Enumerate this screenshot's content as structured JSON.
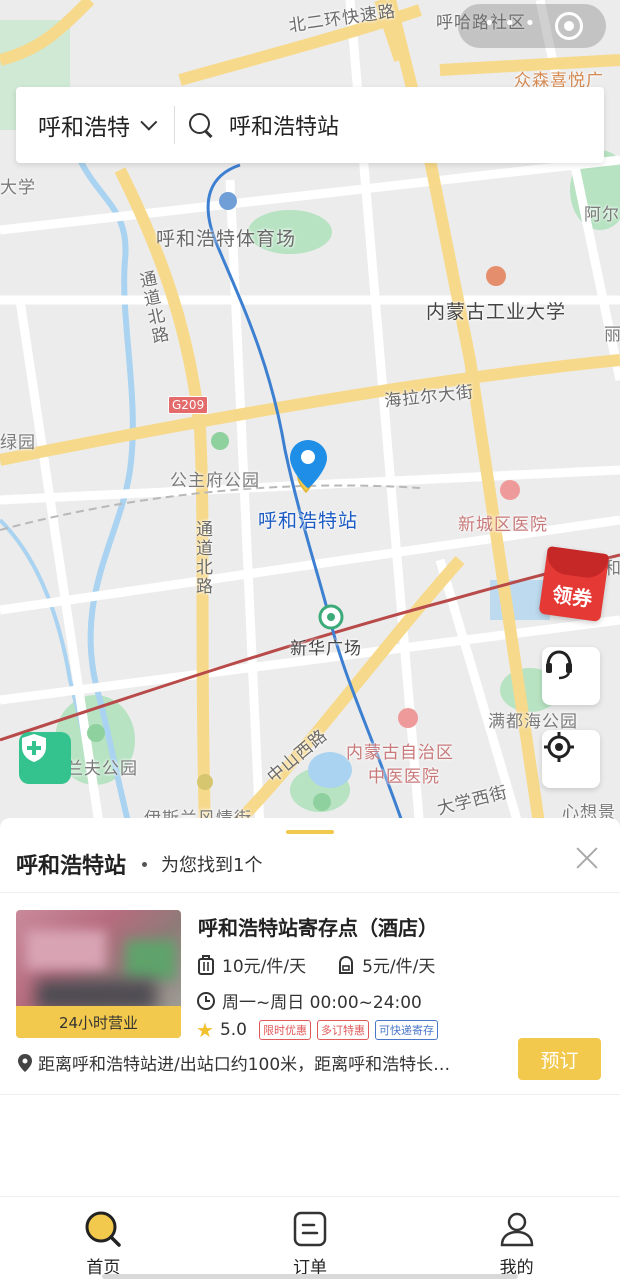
{
  "map": {
    "labels": {
      "beier_ring": "北二环快速路",
      "huha_community": "呼哈路社区",
      "zhongsen": "众森喜悦广",
      "daxue": "大学",
      "sports_field": "呼和浩特体育场",
      "aer": "阿尔",
      "tongdao_north_1": "通道北路",
      "imut": "内蒙古工业大学",
      "li": "丽",
      "g209": "G209",
      "hailar_street": "海拉尔大街",
      "lvyuan": "绿园",
      "gongzhufu_park": "公主府公园",
      "station_label": "呼和浩特站",
      "xincheng_hospital": "新城区医院",
      "he": "和",
      "tongdao_north_2": "通道北路",
      "xinhua_square": "新华广场",
      "mandu_park": "满都海公园",
      "zhongshan_west": "中山西路",
      "imtcm_hospital_line1": "内蒙古自治区",
      "imtcm_hospital_line2": "中医医院",
      "lanfu_park": "兰夫公园",
      "daxue_west": "大学西街",
      "xinjing": "心想景",
      "yisilan_street": "伊斯兰风情街"
    },
    "coupon_label": "领券"
  },
  "search": {
    "city": "呼和浩特",
    "query": "呼和浩特站"
  },
  "sheet": {
    "title": "呼和浩特站",
    "count_text": "为您找到1个"
  },
  "result": {
    "name": "呼和浩特站寄存点（酒店）",
    "badge": "24小时营业",
    "price_luggage": "10元/件/天",
    "price_backpack": "5元/件/天",
    "hours": "周一~周日 00:00~24:00",
    "rating": "5.0",
    "tags": [
      "限时优惠",
      "多订特惠",
      "可快递寄存"
    ],
    "address": "距离呼和浩特站进/出站口约100米，距离呼和浩特长…",
    "book_label": "预订"
  },
  "nav": {
    "items": [
      {
        "label": "首页",
        "icon": "home-search-icon"
      },
      {
        "label": "订单",
        "icon": "order-icon"
      },
      {
        "label": "我的",
        "icon": "profile-icon"
      }
    ]
  },
  "colors": {
    "accent": "#f2c94c",
    "metro_line": "#3d7fd0",
    "rail_line": "#b84a4a",
    "park_green": "#b7e3c2",
    "road_yellow": "#f7d98b"
  }
}
